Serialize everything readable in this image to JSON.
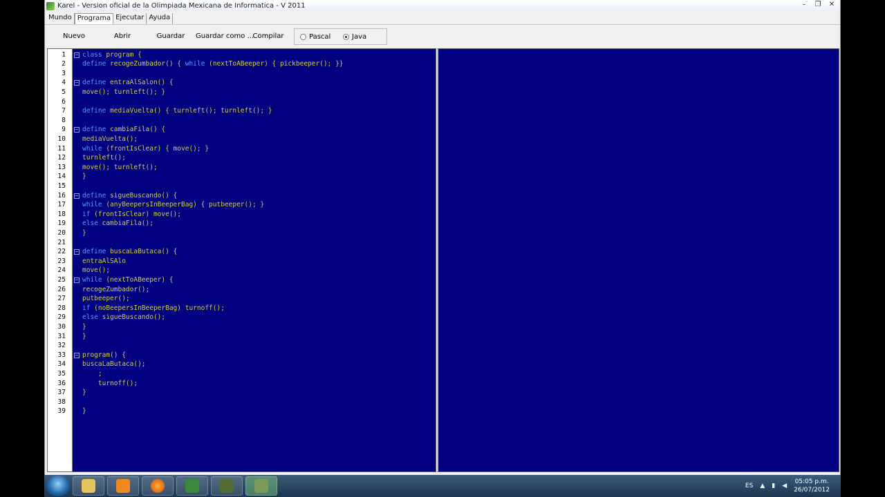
{
  "window": {
    "title": "Karel - Version oficial de la Olimpiada Mexicana de Informatica - V 2011",
    "buttons": [
      "–",
      "❐",
      "✕"
    ]
  },
  "menu": [
    "Mundo",
    "Programa",
    "Ejecutar",
    "Ayuda"
  ],
  "toolbar": {
    "nuevo": "Nuevo",
    "abrir": "Abrir",
    "guardar": "Guardar",
    "guardar_como": "Guardar como ...",
    "compilar": "Compilar",
    "pascal": "Pascal",
    "java": "Java",
    "selected_language": "Java"
  },
  "code": [
    {
      "n": "1",
      "fold": true,
      "text": "class program {"
    },
    {
      "n": "2",
      "fold": false,
      "text": "define recogeZumbador() { while (nextToABeeper) { pickbeeper(); }}"
    },
    {
      "n": "3",
      "fold": false,
      "text": ""
    },
    {
      "n": "4",
      "fold": true,
      "text": "define entraAlSalon() {"
    },
    {
      "n": "5",
      "fold": false,
      "text": "move(); turnleft(); }"
    },
    {
      "n": "6",
      "fold": false,
      "text": ""
    },
    {
      "n": "7",
      "fold": false,
      "text": "define mediaVuelta() { turnleft(); turnleft(); }"
    },
    {
      "n": "8",
      "fold": false,
      "text": ""
    },
    {
      "n": "9",
      "fold": true,
      "text": "define cambiaFila() {"
    },
    {
      "n": "10",
      "fold": false,
      "text": "mediaVuelta();"
    },
    {
      "n": "11",
      "fold": false,
      "text": "while (frontIsClear) { move(); }"
    },
    {
      "n": "12",
      "fold": false,
      "text": "turnleft();"
    },
    {
      "n": "13",
      "fold": false,
      "text": "move(); turnleft();"
    },
    {
      "n": "14",
      "fold": false,
      "text": "}"
    },
    {
      "n": "15",
      "fold": false,
      "text": ""
    },
    {
      "n": "16",
      "fold": true,
      "text": "define sigueBuscando() {"
    },
    {
      "n": "17",
      "fold": false,
      "text": "while (anyBeepersInBeeperBag) { putbeeper(); }"
    },
    {
      "n": "18",
      "fold": false,
      "text": "if (frontIsClear) move();"
    },
    {
      "n": "19",
      "fold": false,
      "text": "else cambiaFila();"
    },
    {
      "n": "20",
      "fold": false,
      "text": "}"
    },
    {
      "n": "21",
      "fold": false,
      "text": ""
    },
    {
      "n": "22",
      "fold": true,
      "text": "define buscaLaButaca() {"
    },
    {
      "n": "23",
      "fold": false,
      "text": "entraAlSAlo"
    },
    {
      "n": "24",
      "fold": false,
      "text": "move();"
    },
    {
      "n": "25",
      "fold": true,
      "text": "while (nextToABeeper) {"
    },
    {
      "n": "26",
      "fold": false,
      "text": "recogeZumbador();"
    },
    {
      "n": "27",
      "fold": false,
      "text": "putbeeper();"
    },
    {
      "n": "28",
      "fold": false,
      "text": "if (noBeepersInBeeperBag) turnoff();"
    },
    {
      "n": "29",
      "fold": false,
      "text": "else sigueBuscando();"
    },
    {
      "n": "30",
      "fold": false,
      "text": "}"
    },
    {
      "n": "31",
      "fold": false,
      "text": "}"
    },
    {
      "n": "32",
      "fold": false,
      "text": ""
    },
    {
      "n": "33",
      "fold": true,
      "text": "program() {"
    },
    {
      "n": "34",
      "fold": false,
      "text": "buscaLaButaca();"
    },
    {
      "n": "35",
      "fold": false,
      "text": "    ;"
    },
    {
      "n": "36",
      "fold": false,
      "text": "    turnoff();"
    },
    {
      "n": "37",
      "fold": false,
      "text": "}"
    },
    {
      "n": "38",
      "fold": false,
      "text": ""
    },
    {
      "n": "39",
      "fold": false,
      "text": "}"
    }
  ],
  "taskbar": {
    "lang": "ES",
    "time": "05:05 p.m.",
    "date": "26/07/2012"
  },
  "colors": {
    "editor_bg": "#000080",
    "code_text": "#d6d23a",
    "keyword": "#4fa0ff"
  }
}
